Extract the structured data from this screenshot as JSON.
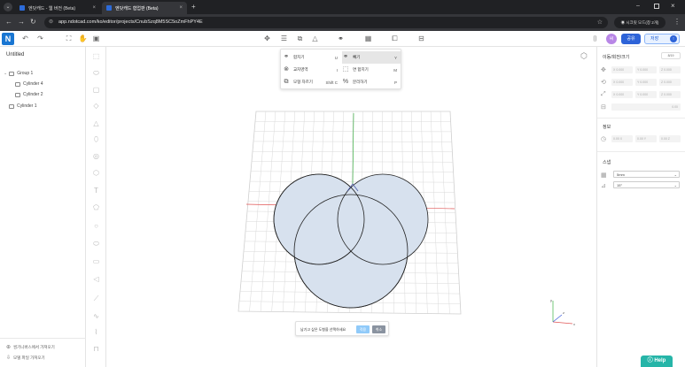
{
  "browser": {
    "tabs": [
      {
        "title": "엔닷캐드 - 웹 버전 (Beta)",
        "active": false
      },
      {
        "title": "엔닷캐드 협업판 (Beta)",
        "active": true
      }
    ],
    "url": "app.ndotcad.com/ko/editor/projects/CnubSzq8M5SC5oZmFhPY4E",
    "profile_label": "시크릿 모드(창 2개)"
  },
  "toolbar": {
    "logo": "N",
    "avatar_initial": "씨",
    "share_label": "공유",
    "save_label": "저장"
  },
  "left_panel": {
    "doc_title": "Untitled",
    "tree": [
      {
        "label": "Group 1",
        "level": 0
      },
      {
        "label": "Cylinder 4",
        "level": 1
      },
      {
        "label": "Cylinder 2",
        "level": 1
      },
      {
        "label": "Cylinder 1",
        "level": 0
      }
    ],
    "library_label": "씽기니버스에서 가져오기",
    "import_label": "모델 파일 가져오기"
  },
  "menu": {
    "items": [
      {
        "label": "합치기",
        "shortcut": "U",
        "icon": "union-icon"
      },
      {
        "label": "빼기",
        "shortcut": "Y",
        "icon": "subtract-icon",
        "highlighted": true
      },
      {
        "label": "교차영역",
        "shortcut": "I",
        "icon": "intersect-icon"
      },
      {
        "label": "면 합치기",
        "shortcut": "M",
        "icon": "merge-faces-icon"
      },
      {
        "label": "모형 자르기",
        "shortcut": "Shift C",
        "icon": "cut-model-icon"
      },
      {
        "label": "분리하기",
        "shortcut": "P",
        "icon": "separate-icon"
      }
    ]
  },
  "prompt": {
    "text": "남기고 싶은 도형을 선택하세요",
    "ok_label": "적용",
    "cancel_label": "취소"
  },
  "right_panel": {
    "transform_title": "이동/회전/크기",
    "step_label": "8/19",
    "position_fields": [
      "X",
      "Y",
      "Z"
    ],
    "field_value": "0.000",
    "size_value": "0.00",
    "placement_title": "정보",
    "placement_fields": [
      "0.00 X",
      "0.00 Y",
      "0.00 Z"
    ],
    "snap_title": "스냅",
    "snap_options": [
      {
        "value": "5mm"
      },
      {
        "value": "15°"
      }
    ]
  },
  "help_label": "Help",
  "axis_labels": {
    "x": "x",
    "y": "y",
    "z": "z"
  },
  "colors": {
    "accent": "#2d63d8",
    "shape_fill": "#d7e1ee",
    "grid_line": "#cccccc",
    "help": "#26b5a8"
  }
}
